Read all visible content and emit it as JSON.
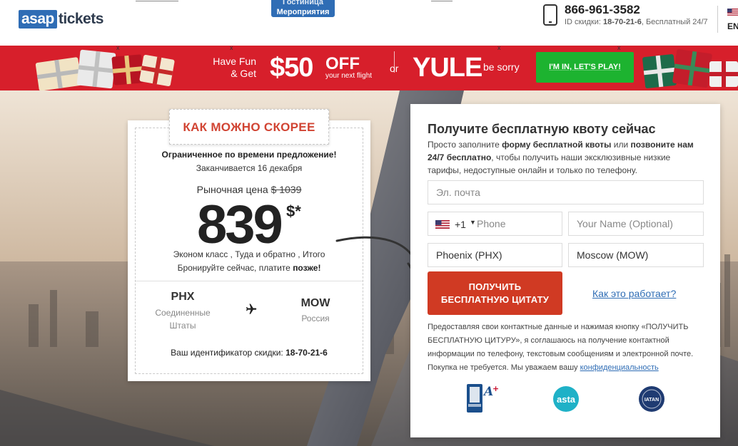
{
  "header": {
    "logo_box": "asap",
    "logo_text": "tickets",
    "nav_badge_line1": "Гостиница",
    "nav_badge_line2": "Мероприятия",
    "phone": "866-961-3582",
    "discount_id_label": "ID скидки:",
    "discount_id": "18-70-21-6",
    "phone_note": ", Бесплатный 24/7",
    "language": "EN"
  },
  "banner": {
    "have_fun": "Have Fun",
    "and_get": "& Get",
    "amount": "$50",
    "off": "OFF",
    "off_sub": "your next flight",
    "or": "or",
    "code": "YULE",
    "be_sorry": "be sorry",
    "cta": "I'M IN, LET'S PLAY!"
  },
  "deal": {
    "tag": "КАК МОЖНО СКОРЕЕ",
    "limited": "Ограниченное по времени предложение!",
    "ends": "Заканчивается 16 декабря",
    "market_label": "Рыночная цена",
    "market_price": "$ 1039",
    "price": "839",
    "currency": "$*",
    "class_info": "Эконом класс , Туда и обратно , Итого",
    "book_now": "Бронируйте сейчас, платите",
    "book_later": "позже!",
    "from_code": "PHX",
    "from_country_1": "Соединенные",
    "from_country_2": "Штаты",
    "to_code": "MOW",
    "to_country": "Россия",
    "discount_label": "Ваш идентификатор скидки:",
    "discount_id": "18-70-21-6"
  },
  "form": {
    "title": "Получите бесплатную квоту сейчас",
    "desc_1": "Просто заполните",
    "desc_b1": "форму бесплатной квоты",
    "desc_2": "или",
    "desc_b2": "позвоните нам 24/7 бесплатно",
    "desc_3": ", чтобы получить наши эксклюзивные низкие тарифы, недоступные онлайн и только по телефону.",
    "email_placeholder": "Эл. почта",
    "phone_code": "+1",
    "phone_placeholder": "Phone",
    "name_placeholder": "Your Name (Optional)",
    "from_value": "Phoenix (PHX)",
    "to_value": "Moscow (MOW)",
    "submit_line1": "ПОЛУЧИТЬ",
    "submit_line2": "БЕСПЛАТНУЮ ЦИТАТУ",
    "how_link": "Как это работает?",
    "disclaimer": "Предоставляя свои контактные данные и нажимая кнопку «ПОЛУЧИТЬ БЕСПЛАТНУЮ ЦИТУРУ», я соглашаюсь на получение контактной информации по телефону, текстовым сообщениям и электронной почте. Покупка не требуется. Мы уважаем вашу",
    "privacy_link": "конфиденциальность",
    "trust": [
      "bbb-a-plus-logo",
      "asta-logo",
      "iatan-logo"
    ]
  },
  "colors": {
    "brand_blue": "#2f6db5",
    "banner_red": "#d71f2b",
    "cta_green": "#1db330",
    "submit_red": "#d03a23",
    "tag_red": "#d14433"
  }
}
